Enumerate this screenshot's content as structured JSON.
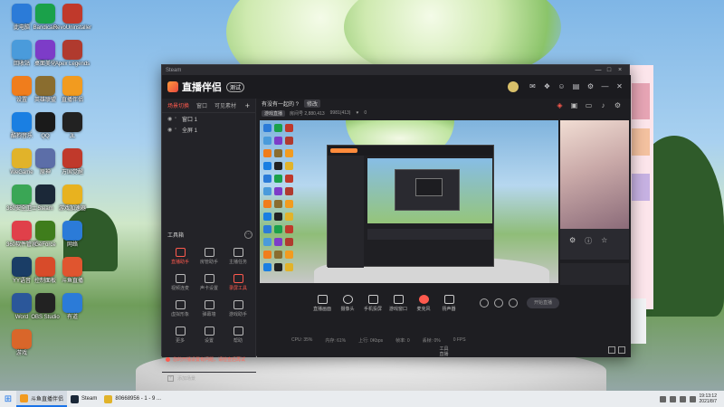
{
  "desktop": {
    "icons": [
      {
        "label": "此电脑",
        "icon": "computer-icon",
        "color": "#2b7bd8"
      },
      {
        "label": "Bandicam",
        "icon": "bandicam-icon",
        "color": "#1aa14a"
      },
      {
        "label": "RevoUninstaller",
        "icon": "uninstaller-icon",
        "color": "#c0392b"
      },
      {
        "label": "回收站",
        "icon": "recycle-bin-icon",
        "color": "#4a9bdb"
      },
      {
        "label": "桌面美化",
        "icon": "desktop-beautify-icon",
        "color": "#7d3cc8"
      },
      {
        "label": "Apex Legends",
        "icon": "apex-icon",
        "color": "#b03a2e"
      },
      {
        "label": "设置",
        "icon": "settings-icon",
        "color": "#f07d1c"
      },
      {
        "label": "英雄联盟",
        "icon": "lol-icon",
        "color": "#8a6d2f"
      },
      {
        "label": "直播伴侣",
        "icon": "live-companion-icon",
        "color": "#f29b1f"
      },
      {
        "label": "酷狗音乐",
        "icon": "kugou-icon",
        "color": "#1a7fe2"
      },
      {
        "label": "QQ",
        "icon": "qq-icon",
        "color": "#1a1a1a"
      },
      {
        "label": "JL",
        "icon": "jl-icon",
        "color": "#222222"
      },
      {
        "label": "WeGame",
        "icon": "wegame-icon",
        "color": "#e1b32a"
      },
      {
        "label": "原神",
        "icon": "genshin-icon",
        "color": "#5c6ea8"
      },
      {
        "label": "万国觉醒",
        "icon": "rok-icon",
        "color": "#c0392b"
      },
      {
        "label": "360安全卫士",
        "icon": "security-icon",
        "color": "#3aa655"
      },
      {
        "label": "Steam",
        "icon": "steam-icon",
        "color": "#1b2838"
      },
      {
        "label": "游戏加速器",
        "icon": "accelerator-icon",
        "color": "#e8b21f"
      },
      {
        "label": "360软件管家",
        "icon": "software-manager-icon",
        "color": "#e0404a"
      },
      {
        "label": "GeForce",
        "icon": "geforce-icon",
        "color": "#3f7d1c"
      },
      {
        "label": "网络",
        "icon": "network-icon",
        "color": "#2b7bd8"
      },
      {
        "label": "YY语音",
        "icon": "yy-icon",
        "color": "#1a3d66"
      },
      {
        "label": "控制面板",
        "icon": "control-panel-icon",
        "color": "#d84b2a"
      },
      {
        "label": "斗鱼直播",
        "icon": "douyu-icon",
        "color": "#e0552f"
      },
      {
        "label": "Word",
        "icon": "word-icon",
        "color": "#2b579a"
      },
      {
        "label": "OBS Studio",
        "icon": "obs-icon",
        "color": "#222222"
      },
      {
        "label": "有道",
        "icon": "youdao-icon",
        "color": "#2b7bd8"
      },
      {
        "label": "游戏",
        "icon": "game-icon",
        "color": "#d9662a"
      }
    ]
  },
  "window": {
    "outer_title": "Steam",
    "controls": [
      "—",
      "□",
      "×"
    ],
    "app_name": "直播伴侣",
    "version_badge": "测试",
    "header_icons": [
      "chat-icon",
      "gift-icon",
      "user-icon",
      "mail-icon",
      "settings-icon",
      "minimize-icon",
      "close-icon"
    ]
  },
  "sidebar": {
    "tabs": [
      "场景切换",
      "窗口",
      "可见素材"
    ],
    "tab_add": "+",
    "scenes": [
      "窗口 1",
      "全屏 1"
    ],
    "tools_title": "工具箱",
    "tools_more": "···",
    "tools": [
      {
        "label": "直播助手",
        "red": true
      },
      {
        "label": "房管助手",
        "red": false
      },
      {
        "label": "主播任务",
        "red": false
      },
      {
        "label": "视频连麦",
        "red": false
      },
      {
        "label": "声卡设置",
        "red": false
      },
      {
        "label": "录屏工具",
        "red": true
      },
      {
        "label": "虚拟形象",
        "red": false
      },
      {
        "label": "弹幕墙",
        "red": false
      },
      {
        "label": "游戏助手",
        "red": false
      },
      {
        "label": "更多",
        "red": false
      },
      {
        "label": "设置",
        "red": false
      },
      {
        "label": "帮助",
        "red": false
      }
    ],
    "tip": "您的开播设置有问题，请检查后再试",
    "footer": "添加场景"
  },
  "main": {
    "stream_title": "有没有一起的 ?",
    "edit_label": "修改",
    "meta": {
      "pill": "游戏直播",
      "room": "房间号 2,880,413",
      "fans": "9981(413)",
      "likes": "0"
    },
    "toolbar": [
      {
        "label": "直播画面",
        "shape": "square"
      },
      {
        "label": "摄像头",
        "shape": "round"
      },
      {
        "label": "手机投屏",
        "shape": "square"
      },
      {
        "label": "游戏窗口",
        "shape": "square"
      },
      {
        "label": "麦克风",
        "shape": "red"
      },
      {
        "label": "扬声器",
        "shape": "square"
      }
    ],
    "start_button": "开始直播",
    "status": [
      "CPU: 35%",
      "内存: 61%",
      "上行: 0Kbps",
      "帧率: 0",
      "丢帧: 0%",
      "0 FPS"
    ],
    "bottom_label": "工具\n直播"
  },
  "taskbar": {
    "apps": [
      {
        "label": "斗鱼直播伴侣",
        "color": "#f29b1f",
        "active": true
      },
      {
        "label": "Steam",
        "color": "#1b2838",
        "active": false
      },
      {
        "label": "80668956 - 1 - 9 ...",
        "color": "#e1b32a",
        "active": false
      }
    ],
    "time": "19:13:12",
    "date": "2021/8/7"
  }
}
